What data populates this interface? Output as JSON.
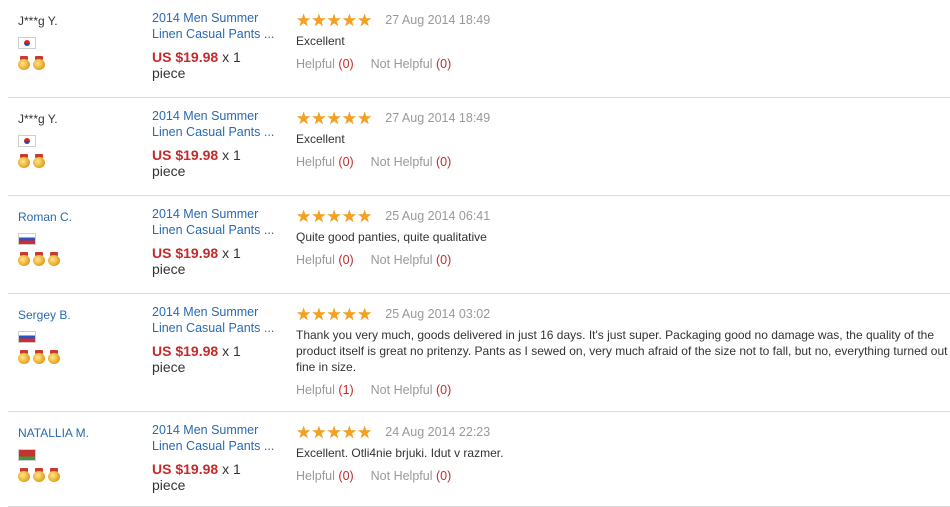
{
  "reviews": [
    {
      "buyer": "J***g Y.",
      "buyer_is_link": false,
      "country": "kr",
      "medals": 2,
      "product": "2014 Men Summer Linen Casual Pants ...",
      "price": "US $19.98",
      "qty": "x 1",
      "unit": "piece",
      "stars": 5,
      "date": "27 Aug 2014 18:49",
      "text": "Excellent",
      "helpful_label": "Helpful",
      "helpful_count": "(0)",
      "not_helpful_label": "Not Helpful",
      "not_helpful_count": "(0)"
    },
    {
      "buyer": "J***g Y.",
      "buyer_is_link": false,
      "country": "kr",
      "medals": 2,
      "product": "2014 Men Summer Linen Casual Pants ...",
      "price": "US $19.98",
      "qty": "x 1",
      "unit": "piece",
      "stars": 5,
      "date": "27 Aug 2014 18:49",
      "text": "Excellent",
      "helpful_label": "Helpful",
      "helpful_count": "(0)",
      "not_helpful_label": "Not Helpful",
      "not_helpful_count": "(0)"
    },
    {
      "buyer": "Roman C.",
      "buyer_is_link": true,
      "country": "ru",
      "medals": 3,
      "product": "2014 Men Summer Linen Casual Pants ...",
      "price": "US $19.98",
      "qty": "x 1",
      "unit": "piece",
      "stars": 5,
      "date": "25 Aug 2014 06:41",
      "text": "Quite good panties, quite qualitative",
      "helpful_label": "Helpful",
      "helpful_count": "(0)",
      "not_helpful_label": "Not Helpful",
      "not_helpful_count": "(0)"
    },
    {
      "buyer": "Sergey B.",
      "buyer_is_link": true,
      "country": "ru",
      "medals": 3,
      "product": "2014 Men Summer Linen Casual Pants ...",
      "price": "US $19.98",
      "qty": "x 1",
      "unit": "piece",
      "stars": 5,
      "date": "25 Aug 2014 03:02",
      "text": "Thank you very much, goods delivered in just 16 days. It's just super. Packaging good no damage was, the quality of the product itself is great no pritenzy. Pants as I sewed on, very much afraid of the size not to fall, but no, everything turned out fine in size.",
      "helpful_label": "Helpful",
      "helpful_count": "(1)",
      "not_helpful_label": "Not Helpful",
      "not_helpful_count": "(0)"
    },
    {
      "buyer": "NATALLIA M.",
      "buyer_is_link": true,
      "country": "by",
      "medals": 3,
      "product": "2014 Men Summer Linen Casual Pants ...",
      "price": "US $19.98",
      "qty": "x 1",
      "unit": "piece",
      "stars": 5,
      "date": "24 Aug 2014 22:23",
      "text": "Excellent. Otli4nie brjuki. Idut v razmer.",
      "helpful_label": "Helpful",
      "helpful_count": "(0)",
      "not_helpful_label": "Not Helpful",
      "not_helpful_count": "(0)"
    }
  ]
}
